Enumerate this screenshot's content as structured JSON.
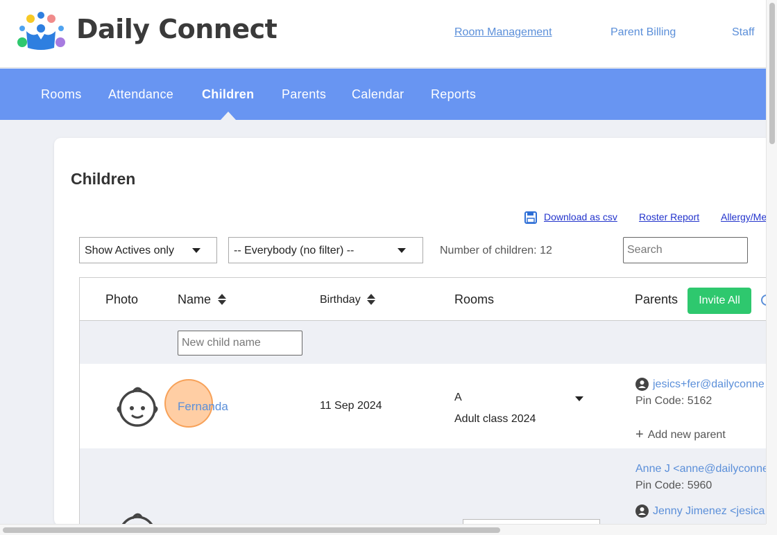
{
  "app": {
    "brand": "Daily Connect",
    "top_links": [
      "Room Management",
      "Parent Billing",
      "Staff"
    ]
  },
  "nav": {
    "items": [
      "Rooms",
      "Attendance",
      "Children",
      "Parents",
      "Calendar",
      "Reports"
    ],
    "active": "Children"
  },
  "page": {
    "title": "Children",
    "tools": {
      "download_csv": "Download as csv",
      "roster_report": "Roster Report",
      "allergy": "Allergy/Me"
    },
    "filters": {
      "status_value": "Show Actives only",
      "room_value": "-- Everybody (no filter) --",
      "count_text": "Number of children: 12",
      "search_placeholder": "Search"
    }
  },
  "table": {
    "headers": {
      "photo": "Photo",
      "name": "Name",
      "birthday": "Birthday",
      "rooms": "Rooms",
      "parents": "Parents"
    },
    "invite_all_label": "Invite All",
    "new_child_placeholder": "New child name",
    "rows": [
      {
        "name": "Fernanda",
        "birthday": "11 Sep 2024",
        "room": "A",
        "room_detail": "Adult class 2024",
        "parents": [
          {
            "label": "jesics+fer@dailyconne",
            "pin": "Pin Code: 5162"
          }
        ],
        "add_parent": "Add new parent"
      },
      {
        "parents": [
          {
            "label": "Anne J <anne@dailyconne",
            "pin": "Pin Code: 5960"
          },
          {
            "label": "Jenny Jimenez <jesica"
          }
        ]
      }
    ]
  },
  "colors": {
    "nav_bg": "#6895f2",
    "link": "#5b8fd9",
    "invite_green": "#2ec86e",
    "highlight": "#ffa55a"
  },
  "icons": [
    "logo-icon",
    "save-icon",
    "sort-icon",
    "baby-face-icon",
    "person-icon",
    "plus-icon",
    "chevron-down-icon"
  ]
}
